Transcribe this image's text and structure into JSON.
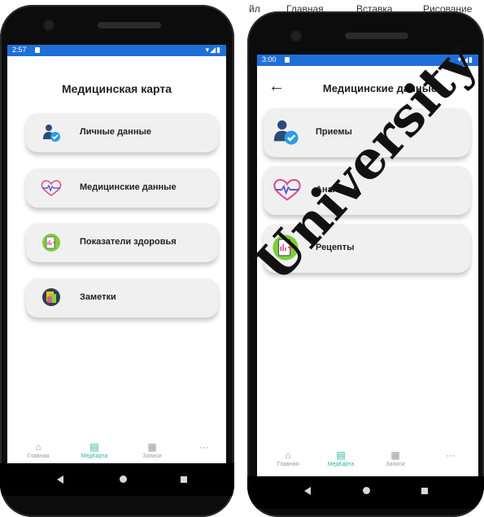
{
  "background_menu": [
    "йл",
    "Главная",
    "Вставка",
    "Рисование"
  ],
  "left_phone": {
    "status_time": "2:57",
    "status_icons": "▾◢▮",
    "title": "Медицинская карта",
    "cards": [
      {
        "label": "Личные данные",
        "icon": "user-check-icon"
      },
      {
        "label": "Медицинские данные",
        "icon": "heart-pulse-icon"
      },
      {
        "label": "Показатели здоровья",
        "icon": "health-chart-icon"
      },
      {
        "label": "Заметки",
        "icon": "notes-icon"
      }
    ]
  },
  "right_phone": {
    "status_time": "3:00",
    "status_icons": "▾◢▮",
    "title": "Медицинские данные",
    "back_icon": "arrow-left-icon",
    "cards": [
      {
        "label": "Приемы",
        "icon": "user-check-icon"
      },
      {
        "label": "Анализы",
        "icon": "heart-pulse-icon"
      },
      {
        "label": "Рецепты",
        "icon": "prescription-icon"
      }
    ]
  },
  "tabbar": {
    "tabs": [
      {
        "label": "Главная",
        "icon": "home-icon",
        "glyph": "⌂"
      },
      {
        "label": "МедКарта",
        "icon": "clipboard-icon",
        "glyph": "▤"
      },
      {
        "label": "Записи",
        "icon": "calendar-icon",
        "glyph": "▦"
      },
      {
        "label": "",
        "icon": "more-icon",
        "glyph": "···"
      }
    ],
    "active_index": 1,
    "active_color": "#2bb3a4"
  },
  "colors": {
    "statusbar": "#1e6fd9",
    "card": "#f0f0f0"
  },
  "watermark": "University"
}
